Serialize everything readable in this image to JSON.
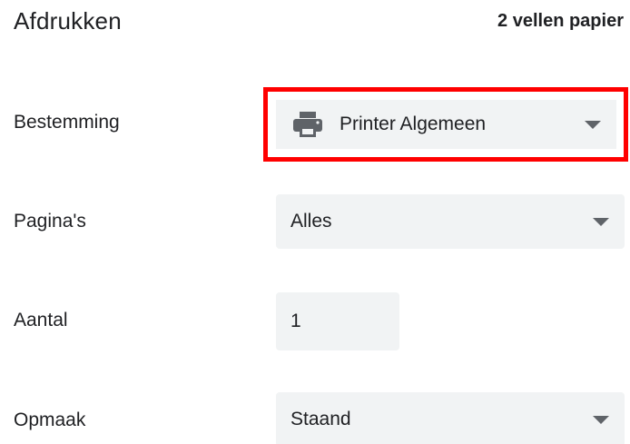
{
  "header": {
    "title": "Afdrukken",
    "sheets": "2 vellen papier"
  },
  "destination": {
    "label": "Bestemming",
    "value": "Printer Algemeen",
    "icon": "printer-icon",
    "highlight_color": "#ff0000"
  },
  "pages": {
    "label": "Pagina's",
    "value": "Alles"
  },
  "copies": {
    "label": "Aantal",
    "value": "1"
  },
  "layout": {
    "label": "Opmaak",
    "value": "Staand"
  },
  "colors": {
    "field_background": "#f1f3f4",
    "text": "#202124",
    "caret": "#5f6368"
  }
}
